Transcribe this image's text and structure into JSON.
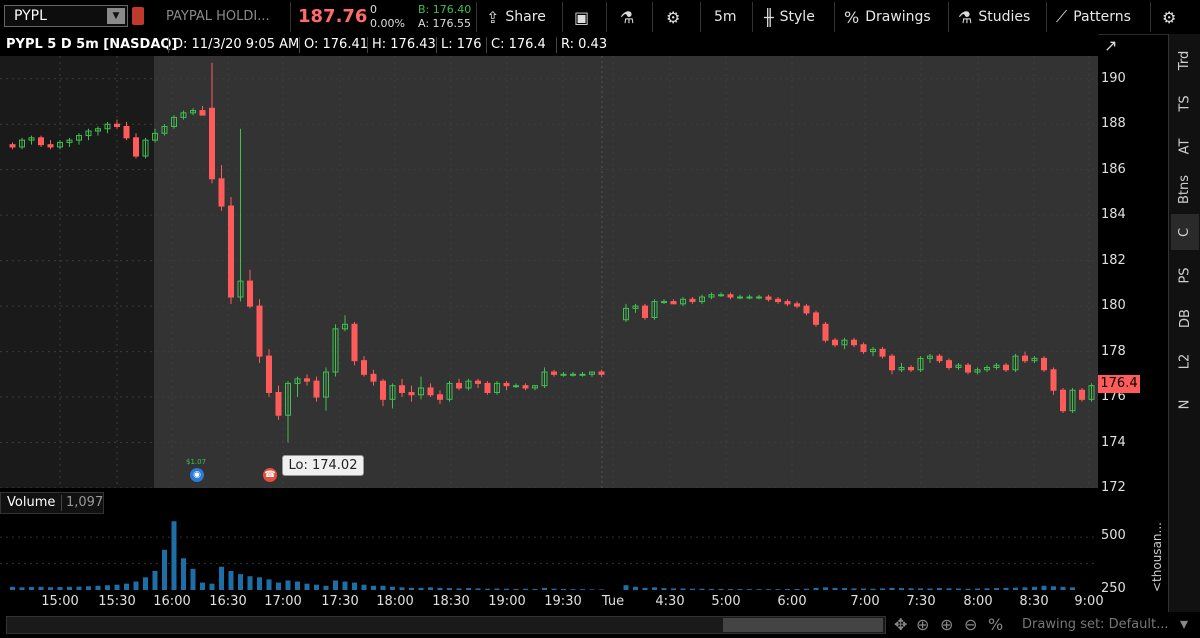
{
  "toolbar": {
    "symbol": "PYPL",
    "company": "PAYPAL HOLDI...",
    "last": "187.76",
    "change": "0",
    "change_pct": "0.00%",
    "bid": "B: 176.40",
    "ask": "A: 176.55",
    "share": "Share",
    "interval": "5m",
    "style": "Style",
    "drawings": "Drawings",
    "studies": "Studies",
    "patterns": "Patterns"
  },
  "header": {
    "title": "PYPL 5 D 5m [NASDAQ]",
    "date": "D: 11/3/20 9:05 AM",
    "open": "O: 176.41",
    "high": "H: 176.43",
    "low": "L: 176",
    "close": "C: 176.4",
    "range": "R: 0.43"
  },
  "volume": {
    "label": "Volume",
    "value": "1,097",
    "ticks": [
      "500",
      "250"
    ],
    "unit_label": "<thousan..."
  },
  "price_tag": "176.4",
  "lo_label": "Lo: 174.02",
  "event_label": "$1.07",
  "sidebar_tabs": [
    "Trd",
    "TS",
    "AT",
    "Btns",
    "C",
    "PS",
    "DB",
    "L2",
    "N"
  ],
  "bottom_status": "Drawing set: Default...",
  "colors": {
    "up": "#3fbf4f",
    "down": "#ff5b5b",
    "volume": "#1e6fa8",
    "ext_hours_bg": "#1a1a1a",
    "session_bg": "#333333"
  },
  "chart_data": {
    "type": "candlestick",
    "ylim": [
      172,
      191
    ],
    "y_ticks": [
      172,
      174,
      176,
      178,
      180,
      182,
      184,
      186,
      188,
      190
    ],
    "x_ticks": [
      "15:00",
      "15:30",
      "16:00",
      "16:30",
      "17:00",
      "17:30",
      "18:00",
      "18:30",
      "19:00",
      "19:30",
      "Tue",
      "4:30",
      "5:00",
      "6:00",
      "7:00",
      "7:30",
      "8:00",
      "8:30",
      "9:00"
    ],
    "candles": [
      [
        187.1,
        187.2,
        186.9,
        187.0
      ],
      [
        187.0,
        187.4,
        186.9,
        187.3
      ],
      [
        187.3,
        187.5,
        187.1,
        187.4
      ],
      [
        187.4,
        187.5,
        187.0,
        187.1
      ],
      [
        187.1,
        187.3,
        186.9,
        187.0
      ],
      [
        187.0,
        187.3,
        186.9,
        187.2
      ],
      [
        187.2,
        187.4,
        187.0,
        187.3
      ],
      [
        187.3,
        187.6,
        187.1,
        187.5
      ],
      [
        187.5,
        187.8,
        187.3,
        187.7
      ],
      [
        187.7,
        187.9,
        187.5,
        187.8
      ],
      [
        187.8,
        188.1,
        187.6,
        188.0
      ],
      [
        188.0,
        188.2,
        187.8,
        187.9
      ],
      [
        187.9,
        188.1,
        187.3,
        187.4
      ],
      [
        187.4,
        187.6,
        186.5,
        186.6
      ],
      [
        186.6,
        187.4,
        186.5,
        187.3
      ],
      [
        187.3,
        187.8,
        187.2,
        187.6
      ],
      [
        187.6,
        188.0,
        187.5,
        187.9
      ],
      [
        187.9,
        188.4,
        187.8,
        188.3
      ],
      [
        188.3,
        188.6,
        188.2,
        188.5
      ],
      [
        188.5,
        188.7,
        188.4,
        188.6
      ],
      [
        188.6,
        188.8,
        188.4,
        188.4
      ],
      [
        188.7,
        190.7,
        185.4,
        185.6
      ],
      [
        185.6,
        186.2,
        184.2,
        184.4
      ],
      [
        184.4,
        184.8,
        180.1,
        180.4
      ],
      [
        180.4,
        187.8,
        180.2,
        181.1
      ],
      [
        181.1,
        181.6,
        179.9,
        180.0
      ],
      [
        180.0,
        180.3,
        177.5,
        177.8
      ],
      [
        177.8,
        178.1,
        176.0,
        176.2
      ],
      [
        176.2,
        176.5,
        175.0,
        175.2
      ],
      [
        175.2,
        176.7,
        174.0,
        176.6
      ],
      [
        176.6,
        176.9,
        176.0,
        176.8
      ],
      [
        176.8,
        177.0,
        176.5,
        176.7
      ],
      [
        176.7,
        176.9,
        175.8,
        176.0
      ],
      [
        176.0,
        177.3,
        175.4,
        177.1
      ],
      [
        177.1,
        179.2,
        176.9,
        179.0
      ],
      [
        179.0,
        179.6,
        178.9,
        179.2
      ],
      [
        179.2,
        179.3,
        177.4,
        177.6
      ],
      [
        177.6,
        177.8,
        176.9,
        177.0
      ],
      [
        177.0,
        177.2,
        176.5,
        176.7
      ],
      [
        176.7,
        176.8,
        175.6,
        175.9
      ],
      [
        175.9,
        176.6,
        175.5,
        176.5
      ],
      [
        176.5,
        176.8,
        176.0,
        176.2
      ],
      [
        176.2,
        176.5,
        175.8,
        176.1
      ],
      [
        176.1,
        176.9,
        175.9,
        176.4
      ],
      [
        176.4,
        176.6,
        176.0,
        176.1
      ],
      [
        176.1,
        176.3,
        175.7,
        175.9
      ],
      [
        175.9,
        176.7,
        175.8,
        176.6
      ],
      [
        176.6,
        176.8,
        176.3,
        176.4
      ],
      [
        176.4,
        176.8,
        176.3,
        176.7
      ],
      [
        176.7,
        176.8,
        176.4,
        176.6
      ],
      [
        176.6,
        176.7,
        176.1,
        176.2
      ],
      [
        176.2,
        176.7,
        176.1,
        176.6
      ],
      [
        176.6,
        176.7,
        176.3,
        176.5
      ],
      [
        176.5,
        176.6,
        176.4,
        176.5
      ],
      [
        176.5,
        176.6,
        176.3,
        176.4
      ],
      [
        176.4,
        176.5,
        176.3,
        176.5
      ],
      [
        176.5,
        177.3,
        176.4,
        177.1
      ],
      [
        177.1,
        177.2,
        176.9,
        177.0
      ],
      [
        177.0,
        177.1,
        176.9,
        177.0
      ],
      [
        177.0,
        177.1,
        176.9,
        177.0
      ],
      [
        177.0,
        177.1,
        176.9,
        177.0
      ],
      [
        177.0,
        177.1,
        176.9,
        177.1
      ],
      [
        177.1,
        177.2,
        176.9,
        177.0
      ],
      [
        179.4,
        180.1,
        179.3,
        179.9
      ],
      [
        179.9,
        180.1,
        179.7,
        180.0
      ],
      [
        180.0,
        180.1,
        179.4,
        179.5
      ],
      [
        179.5,
        180.3,
        179.4,
        180.2
      ],
      [
        180.2,
        180.3,
        180.1,
        180.2
      ],
      [
        180.2,
        180.3,
        180.1,
        180.1
      ],
      [
        180.1,
        180.4,
        180.0,
        180.3
      ],
      [
        180.3,
        180.4,
        180.1,
        180.2
      ],
      [
        180.2,
        180.5,
        180.1,
        180.4
      ],
      [
        180.4,
        180.6,
        180.3,
        180.5
      ],
      [
        180.5,
        180.6,
        180.4,
        180.5
      ],
      [
        180.5,
        180.6,
        180.3,
        180.4
      ],
      [
        180.4,
        180.5,
        180.3,
        180.4
      ],
      [
        180.4,
        180.5,
        180.3,
        180.4
      ],
      [
        180.4,
        180.5,
        180.3,
        180.4
      ],
      [
        180.4,
        180.5,
        180.2,
        180.3
      ],
      [
        180.3,
        180.4,
        180.1,
        180.2
      ],
      [
        180.2,
        180.3,
        180.0,
        180.1
      ],
      [
        180.1,
        180.2,
        179.9,
        180.0
      ],
      [
        180.0,
        180.1,
        179.6,
        179.7
      ],
      [
        179.7,
        179.8,
        179.1,
        179.2
      ],
      [
        179.2,
        179.3,
        178.4,
        178.5
      ],
      [
        178.5,
        178.6,
        178.2,
        178.3
      ],
      [
        178.3,
        178.6,
        178.1,
        178.5
      ],
      [
        178.5,
        178.6,
        178.2,
        178.3
      ],
      [
        178.3,
        178.4,
        177.9,
        178.0
      ],
      [
        178.0,
        178.2,
        177.8,
        178.1
      ],
      [
        178.1,
        178.2,
        177.7,
        177.8
      ],
      [
        177.8,
        177.9,
        177.0,
        177.2
      ],
      [
        177.2,
        177.5,
        177.1,
        177.3
      ],
      [
        177.3,
        177.4,
        177.1,
        177.2
      ],
      [
        177.2,
        177.8,
        177.1,
        177.7
      ],
      [
        177.7,
        177.9,
        177.5,
        177.8
      ],
      [
        177.8,
        177.9,
        177.5,
        177.6
      ],
      [
        177.6,
        177.7,
        177.2,
        177.3
      ],
      [
        177.3,
        177.5,
        177.2,
        177.4
      ],
      [
        177.4,
        177.5,
        177.0,
        177.1
      ],
      [
        177.1,
        177.3,
        177.0,
        177.2
      ],
      [
        177.2,
        177.4,
        177.1,
        177.3
      ],
      [
        177.3,
        177.5,
        177.2,
        177.4
      ],
      [
        177.4,
        177.5,
        177.1,
        177.2
      ],
      [
        177.2,
        177.9,
        177.1,
        177.8
      ],
      [
        177.8,
        178.0,
        177.5,
        177.6
      ],
      [
        177.6,
        177.8,
        177.5,
        177.7
      ],
      [
        177.7,
        177.8,
        177.1,
        177.2
      ],
      [
        177.2,
        177.3,
        176.1,
        176.3
      ],
      [
        176.3,
        176.4,
        175.3,
        175.4
      ],
      [
        175.4,
        176.4,
        175.3,
        176.3
      ],
      [
        176.3,
        176.4,
        175.8,
        175.9
      ],
      [
        175.9,
        176.6,
        175.8,
        176.5
      ],
      [
        176.5,
        176.6,
        176.0,
        176.4
      ]
    ],
    "volume_thousands": [
      30,
      25,
      28,
      30,
      26,
      28,
      30,
      32,
      35,
      40,
      45,
      50,
      60,
      80,
      120,
      180,
      380,
      650,
      300,
      200,
      70,
      60,
      220,
      180,
      150,
      130,
      120,
      100,
      70,
      90,
      80,
      60,
      50,
      40,
      90,
      80,
      70,
      50,
      40,
      40,
      30,
      25,
      20,
      20,
      25,
      20,
      18,
      15,
      18,
      15,
      12,
      14,
      12,
      10,
      12,
      10,
      20,
      12,
      10,
      8,
      8,
      6,
      6,
      45,
      30,
      20,
      25,
      18,
      15,
      14,
      12,
      12,
      10,
      10,
      9,
      9,
      8,
      8,
      8,
      8,
      9,
      10,
      12,
      20,
      25,
      20,
      18,
      15,
      14,
      12,
      15,
      20,
      18,
      16,
      15,
      14,
      18,
      16,
      14,
      12,
      14,
      16,
      18,
      20,
      22,
      25,
      30,
      40,
      35,
      30,
      25
    ]
  }
}
